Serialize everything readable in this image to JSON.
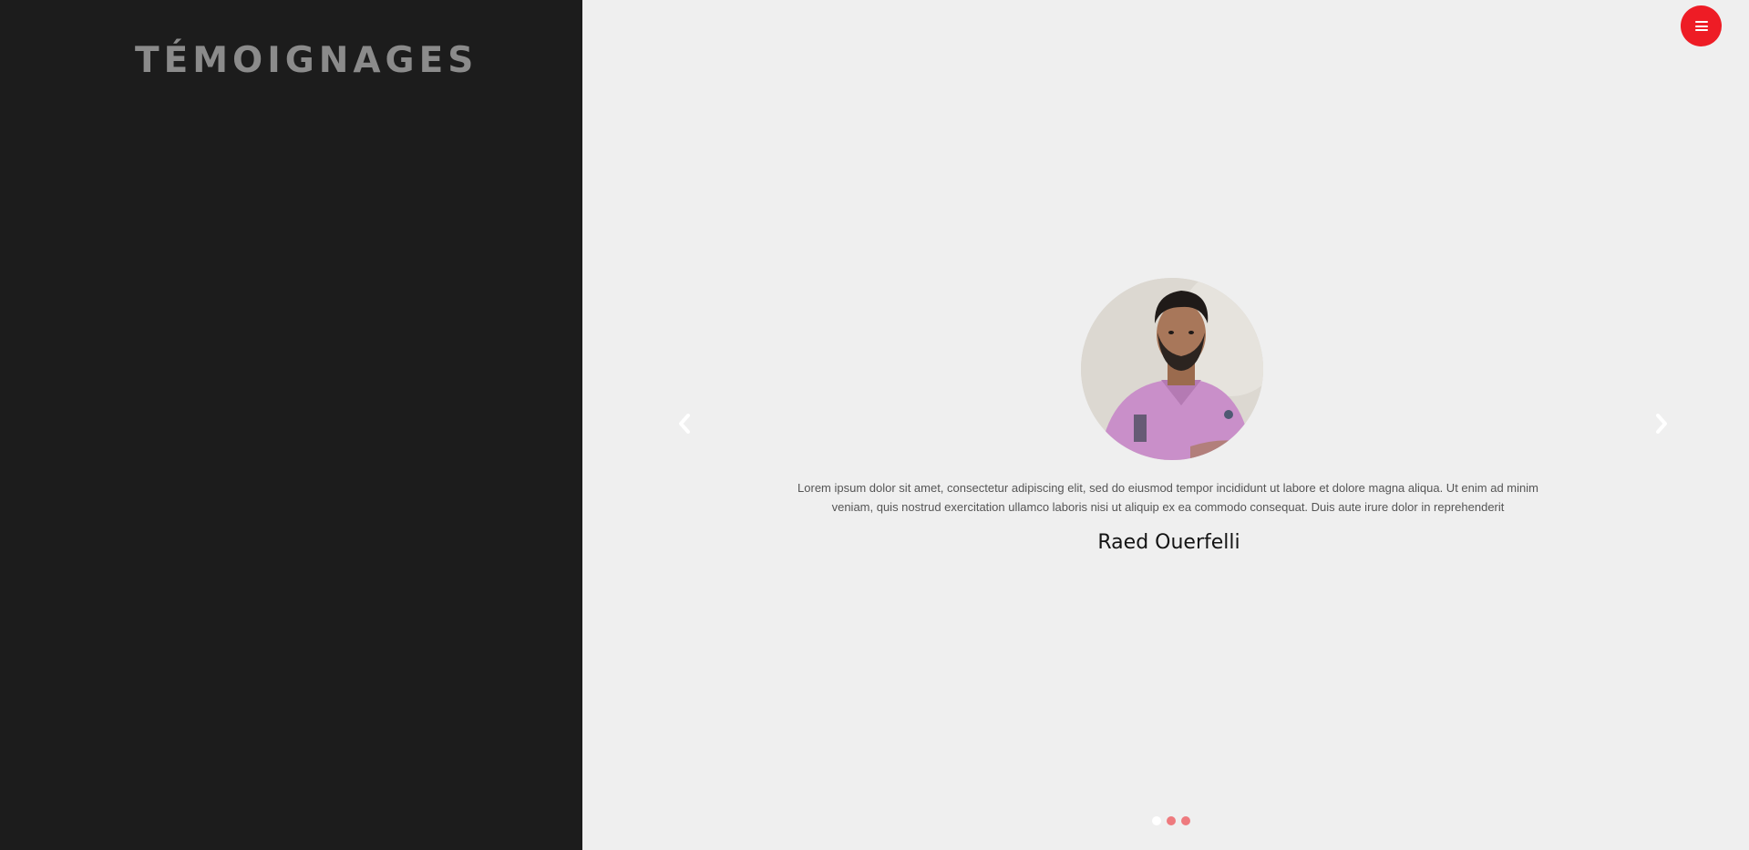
{
  "left": {
    "title": "TÉMOIGNAGES"
  },
  "header": {
    "menu_icon": "hamburger-menu-icon"
  },
  "carousel": {
    "prev_icon": "chevron-left-icon",
    "next_icon": "chevron-right-icon",
    "active_index": 0,
    "slide_count": 3,
    "testimonial": {
      "text": "Lorem ipsum dolor sit amet, consectetur adipiscing elit, sed do eiusmod tempor incididunt ut labore et dolore magna aliqua. Ut enim ad minim veniam, quis nostrud exercitation ullamco laboris nisi ut aliquip ex ea commodo consequat. Duis aute irure dolor in reprehenderit",
      "author": "Raed Ouerfelli"
    }
  },
  "colors": {
    "left_background": "#1c1c1c",
    "right_background": "#efefef",
    "accent": "#ee1c25",
    "dot_inactive": "#ee7a7e",
    "dot_active": "#ffffff",
    "title_text": "#8b8b8b"
  }
}
